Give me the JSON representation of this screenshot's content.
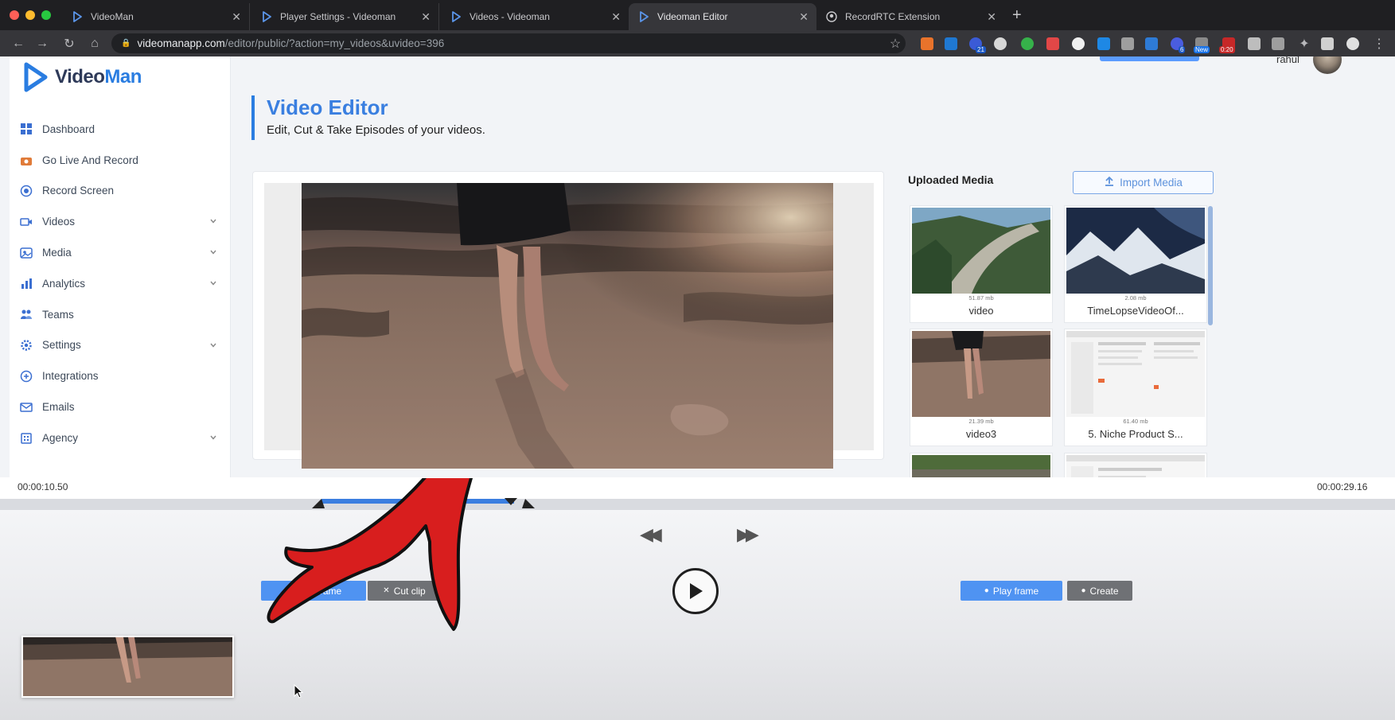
{
  "browser": {
    "tabs": [
      {
        "title": "VideoMan",
        "active": false
      },
      {
        "title": "Player Settings - Videoman",
        "active": false
      },
      {
        "title": "Videos - Videoman",
        "active": false
      },
      {
        "title": "Videoman Editor",
        "active": true
      },
      {
        "title": "RecordRTC Extension",
        "active": false
      }
    ],
    "url_host": "videomanapp.com",
    "url_path": "/editor/public/?action=my_videos&uvideo=396",
    "extension_badges": [
      "21",
      "6",
      "New",
      "0:20"
    ]
  },
  "sidebar": {
    "logo_text_1": "Video",
    "logo_text_2": "Man",
    "logo_subtitle": "",
    "items": [
      {
        "label": "Dashboard",
        "icon": "dashboard-icon",
        "has_submenu": false
      },
      {
        "label": "Go Live And Record",
        "icon": "live-icon",
        "has_submenu": false
      },
      {
        "label": "Record Screen",
        "icon": "record-icon",
        "has_submenu": false
      },
      {
        "label": "Videos",
        "icon": "video-icon",
        "has_submenu": true
      },
      {
        "label": "Media",
        "icon": "media-icon",
        "has_submenu": true
      },
      {
        "label": "Analytics",
        "icon": "analytics-icon",
        "has_submenu": true
      },
      {
        "label": "Teams",
        "icon": "teams-icon",
        "has_submenu": false
      },
      {
        "label": "Settings",
        "icon": "settings-icon",
        "has_submenu": true
      },
      {
        "label": "Integrations",
        "icon": "integrations-icon",
        "has_submenu": false
      },
      {
        "label": "Emails",
        "icon": "emails-icon",
        "has_submenu": false
      },
      {
        "label": "Agency",
        "icon": "agency-icon",
        "has_submenu": true
      }
    ]
  },
  "header": {
    "user_name": "rahul"
  },
  "editor": {
    "title": "Video Editor",
    "subtitle": "Edit, Cut & Take Episodes of your videos."
  },
  "media": {
    "title": "Uploaded Media",
    "import_label": "Import Media",
    "items": [
      {
        "name": "video",
        "size": "51.87 mb"
      },
      {
        "name": "TimeLopseVideoOf...",
        "size": "2.08 mb"
      },
      {
        "name": "video3",
        "size": "21.39 mb"
      },
      {
        "name": "5. Niche Product S...",
        "size": "61.40 mb"
      },
      {
        "name": "",
        "size": ""
      },
      {
        "name": "",
        "size": ""
      }
    ]
  },
  "timeline": {
    "start_time": "00:00:10.50",
    "end_time": "00:00:29.16"
  },
  "controls": {
    "take_frame_label": "Take frame",
    "cut_clip_label": "Cut clip",
    "play_frame_label": "Play frame",
    "create_label": "Create"
  },
  "colors": {
    "accent": "#2a7de1",
    "button_blue": "#4f93f2",
    "button_gray": "#6f7175",
    "annotation_red": "#d81e1e"
  }
}
